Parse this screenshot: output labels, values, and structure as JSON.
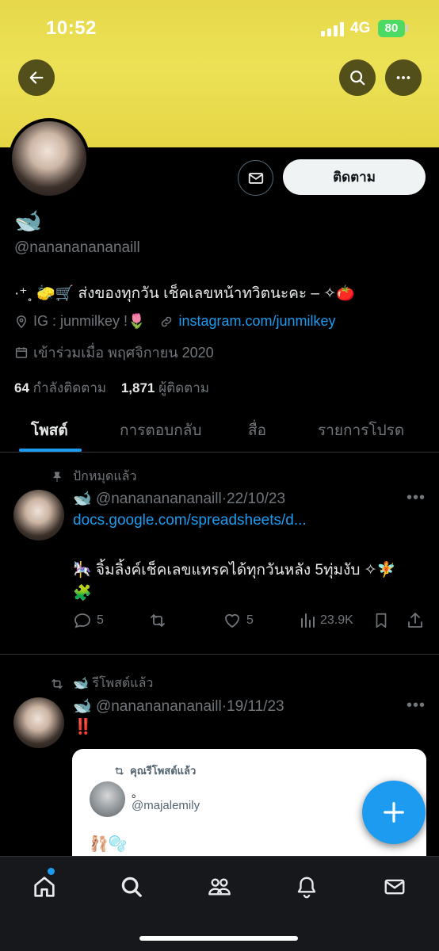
{
  "status_bar": {
    "time": "10:52",
    "network": "4G",
    "battery": "80"
  },
  "profile": {
    "display_name": "🐋",
    "handle": "@nanananananaill",
    "bio": "·⁺˳ 🧽🛒 ส่งของทุกวัน เช็คเลขหน้าทวิตนะคะ – ✧🍅",
    "ig_label": "IG : junmilkey !🌷",
    "link": "instagram.com/junmilkey",
    "joined": "เข้าร่วมเมื่อ พฤศจิกายน 2020",
    "following_count": "64",
    "following_label": "กำลังติดตาม",
    "followers_count": "1,871",
    "followers_label": "ผู้ติดตาม",
    "follow_button": "ติดตาม"
  },
  "tabs": [
    {
      "label": "โพสต์"
    },
    {
      "label": "การตอบกลับ"
    },
    {
      "label": "สื่อ"
    },
    {
      "label": "รายการโปรด"
    }
  ],
  "tweets": [
    {
      "context": "ปักหมุดแล้ว",
      "name": "🐋",
      "handle": "@nanananananaill",
      "date": "22/10/23",
      "link": "docs.google.com/spreadsheets/d...",
      "body": "🎠 จิ้มลิ้งค์เช็คเลขแทรคได้ทุกวันหลัง 5ทุ่มงับ ✧🧚",
      "body2": "🧩",
      "replies": "5",
      "likes": "5",
      "views": "23.9K"
    },
    {
      "context": "🐋 รีโพสต์แล้ว",
      "name": "🐋",
      "handle": "@nanananananaill",
      "date": "19/11/23",
      "body": "‼️",
      "quote": {
        "context": "คุณรีโพสต์แล้ว",
        "name": "。",
        "handle": "@majalemily",
        "body": "🩰🫧"
      }
    }
  ],
  "colors": {
    "banner": "#e6d84a",
    "accent": "#1d9bf0",
    "background": "#000000"
  }
}
